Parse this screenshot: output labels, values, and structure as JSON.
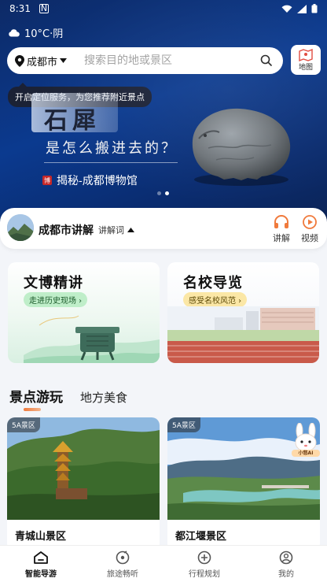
{
  "status_bar": {
    "time": "8:31",
    "notification": "N"
  },
  "weather": {
    "text": "10°C·阴"
  },
  "search": {
    "city": "成都市",
    "placeholder": "搜索目的地或景区"
  },
  "map_button": {
    "label": "地图"
  },
  "tooltip": {
    "text": "开启定位服务，为您推荐附近景点"
  },
  "banner": {
    "title": "石犀",
    "subtitle": "是怎么搬进去的？",
    "seal": "博",
    "tag": "揭秘-成都博物馆",
    "page_count": 2,
    "active_page": 2
  },
  "guide": {
    "title": "成都市讲解",
    "words_label": "讲解词",
    "action_audio": "讲解",
    "action_video": "视频"
  },
  "features": [
    {
      "title": "文博精讲",
      "pill": "走进历史现场 ›"
    },
    {
      "title": "名校导览",
      "pill": "感受名校风范 ›"
    }
  ],
  "tabs": [
    {
      "label": "景点游玩",
      "active": true
    },
    {
      "label": "地方美食",
      "active": false
    }
  ],
  "scenic_spots": [
    {
      "badge": "5A景区",
      "name": "青城山景区"
    },
    {
      "badge": "5A景区",
      "name": "都江堰景区"
    }
  ],
  "ai_assistant": {
    "label": "小悠AI"
  },
  "bottom_nav": [
    {
      "label": "智能导游",
      "icon": "home-icon",
      "active": true
    },
    {
      "label": "旅途畅听",
      "icon": "music-disc-icon",
      "active": false
    },
    {
      "label": "行程规划",
      "icon": "plan-plus-icon",
      "active": false
    },
    {
      "label": "我的",
      "icon": "user-icon",
      "active": false
    }
  ],
  "colors": {
    "hero": "#0b3a8f",
    "accent": "#f07a3c",
    "pill_green": "#bfeec9",
    "pill_yellow": "#fbe7a6"
  }
}
